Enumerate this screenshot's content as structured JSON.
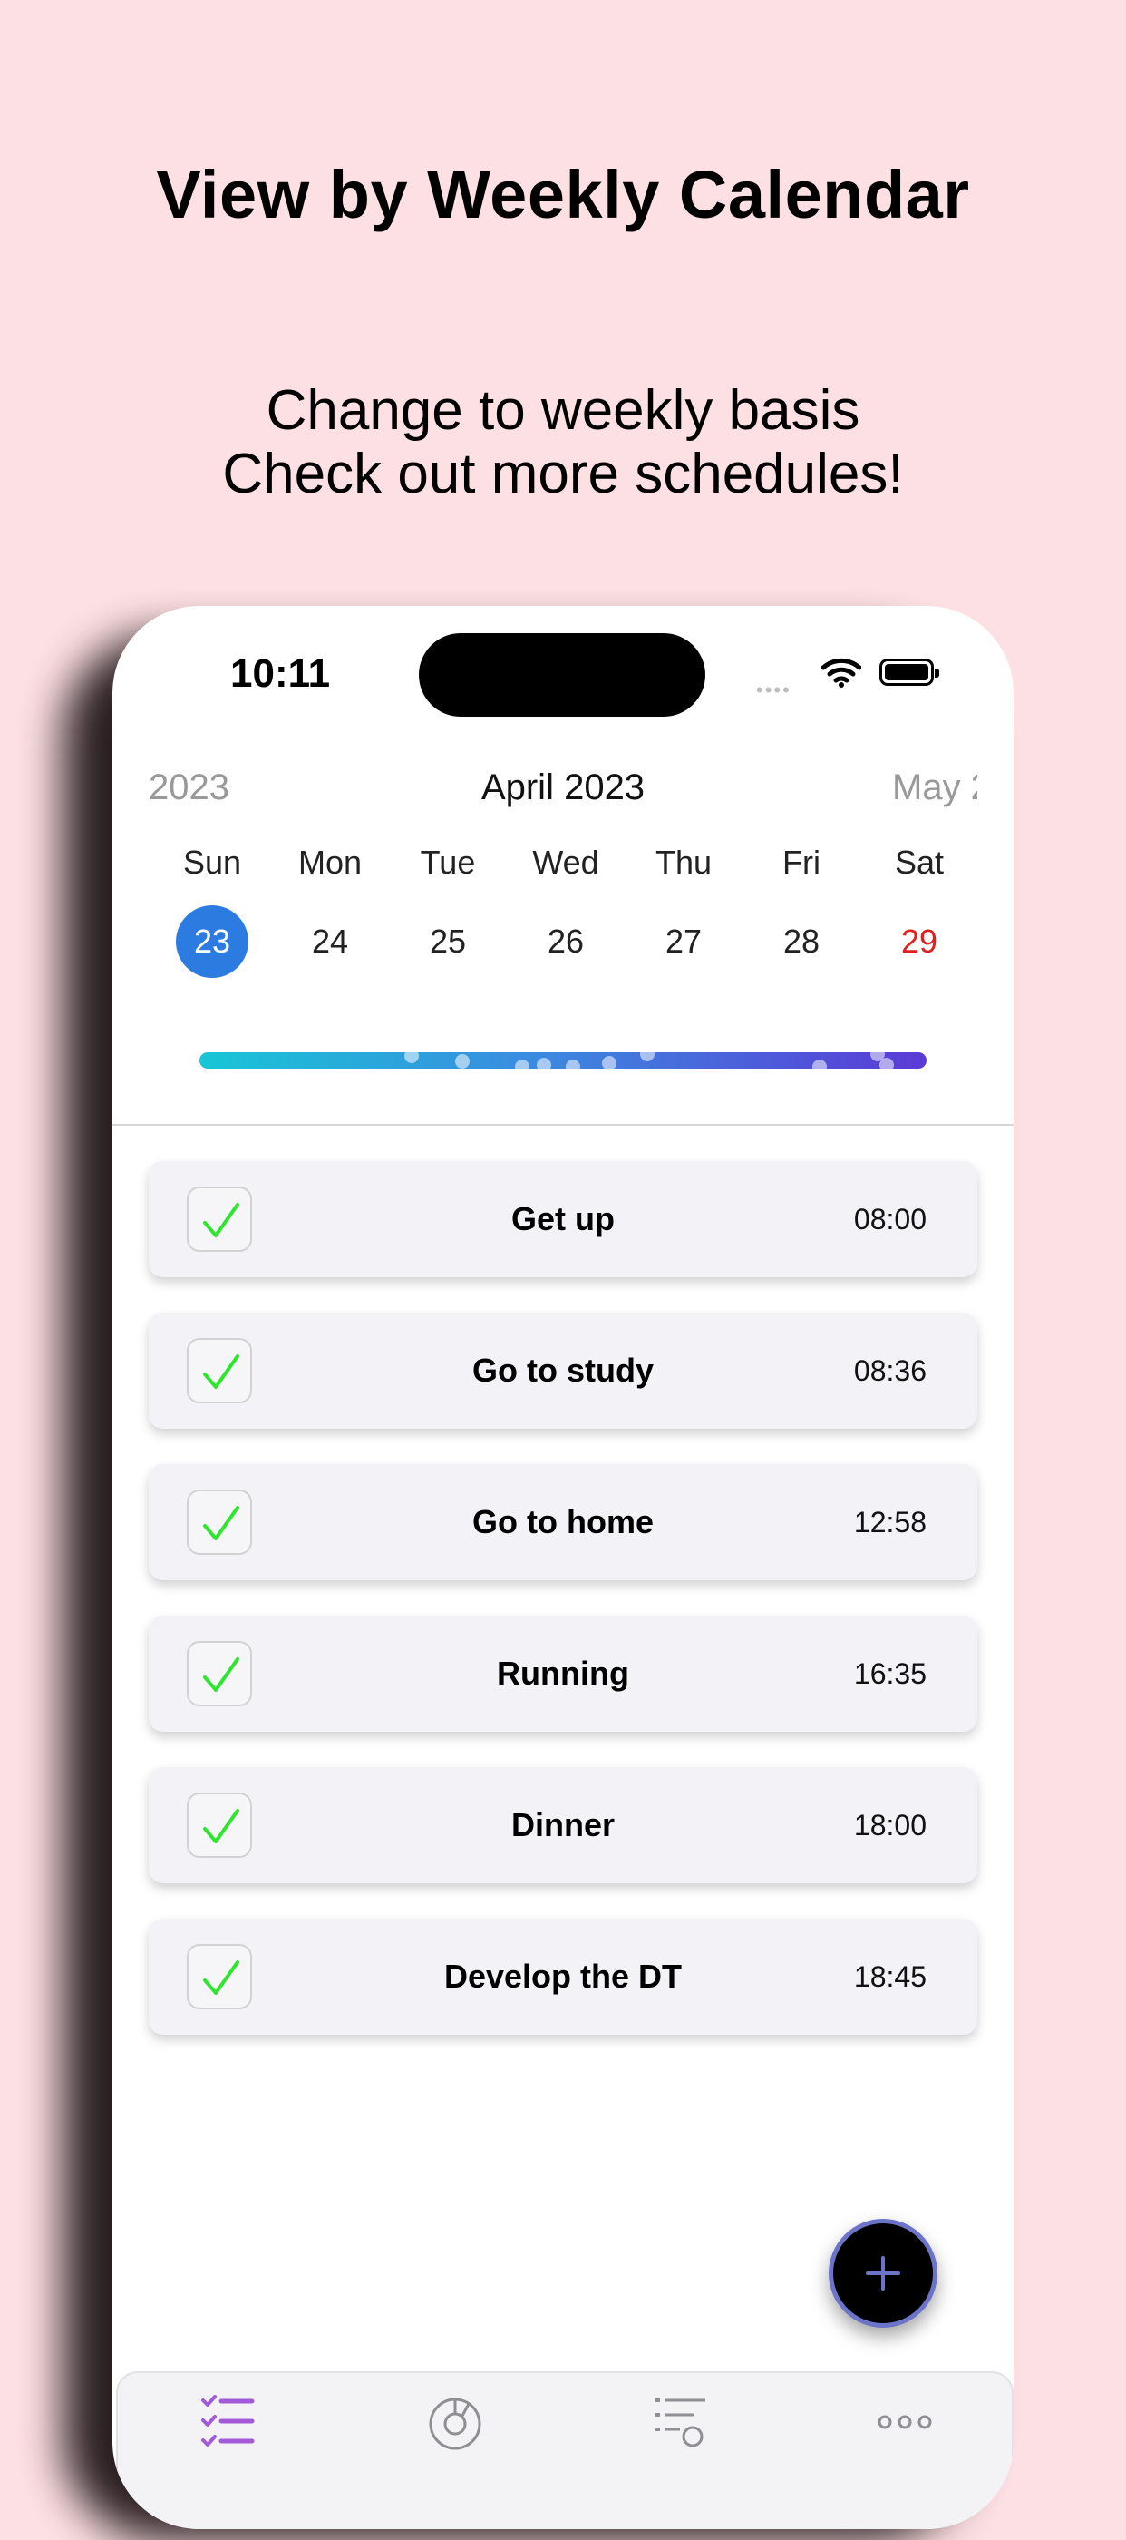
{
  "promo": {
    "headline": "View by Weekly Calendar",
    "subline1": "Change to weekly basis",
    "subline2": "Check out more schedules!"
  },
  "status_bar": {
    "time": "10:11",
    "signal": "••••"
  },
  "calendar": {
    "prev_month": "2023",
    "current_month": "April 2023",
    "next_month": "May 2",
    "weekdays": [
      "Sun",
      "Mon",
      "Tue",
      "Wed",
      "Thu",
      "Fri",
      "Sat"
    ],
    "days": [
      "23",
      "24",
      "25",
      "26",
      "27",
      "28",
      "29"
    ],
    "selected_day": "23",
    "selected_color": "#2c7be0",
    "weekend_color": "#e0201e"
  },
  "tasks": [
    {
      "title": "Get up",
      "time": "08:00",
      "done": true
    },
    {
      "title": "Go to study",
      "time": "08:36",
      "done": true
    },
    {
      "title": "Go to home",
      "time": "12:58",
      "done": true
    },
    {
      "title": "Running",
      "time": "16:35",
      "done": true
    },
    {
      "title": "Dinner",
      "time": "18:00",
      "done": true
    },
    {
      "title": "Develop the DT",
      "time": "18:45",
      "done": true
    }
  ],
  "colors": {
    "background": "#fde0e3",
    "check": "#2ee62e",
    "accent": "#a35ad9"
  },
  "fab": {
    "icon": "plus-icon"
  },
  "tabbar": {
    "tabs": [
      {
        "icon": "checklist-icon",
        "active": true
      },
      {
        "icon": "chart-icon",
        "active": false
      },
      {
        "icon": "list-search-icon",
        "active": false
      },
      {
        "icon": "more-icon",
        "active": false
      }
    ]
  }
}
